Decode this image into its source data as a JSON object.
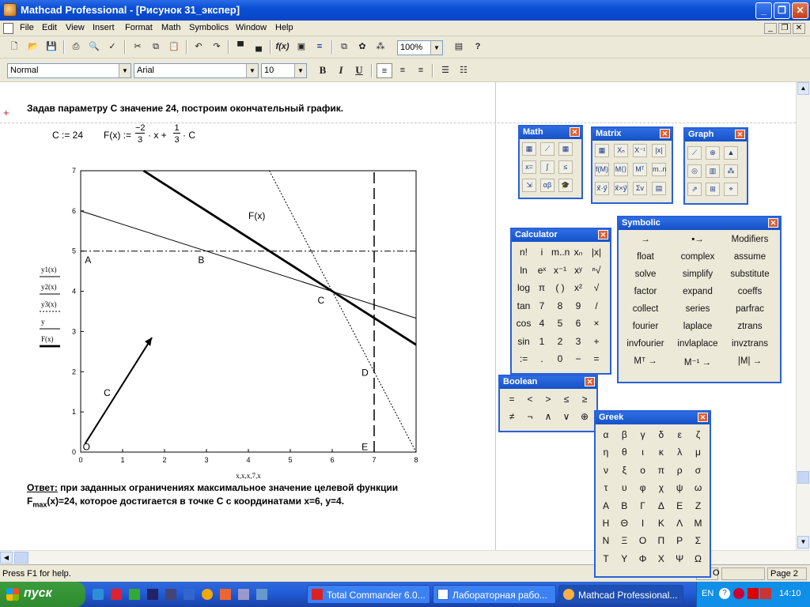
{
  "window": {
    "title": "Mathcad Professional - [Рисунок 31_экспер]"
  },
  "menu": [
    "File",
    "Edit",
    "View",
    "Insert",
    "Format",
    "Math",
    "Symbolics",
    "Window",
    "Help"
  ],
  "toolbar": {
    "zoom": "100%"
  },
  "format": {
    "style": "Normal",
    "font": "Arial",
    "size": "10",
    "bold": "B",
    "italic": "I",
    "underline": "U"
  },
  "document": {
    "heading": "Задав параметру C значение 24, построим окончательный график.",
    "formula": {
      "c_def": "C := 24",
      "f_def": "F(x) :=",
      "num1": "−2",
      "den1": "3",
      "mid": "· x +",
      "num2": "1",
      "den2": "3",
      "tail": "· C"
    },
    "answer_label": "Ответ:",
    "answer_text": " при заданных ограничениях максимальное значение целевой функции",
    "answer_line2_f": "F",
    "answer_line2_sub": "max",
    "answer_line2_rest": "(x)=24, которое достигается в точке C с координатами x=6, y=4."
  },
  "chart_data": {
    "type": "line",
    "xlabel": "x,x,x,7,x",
    "xlim": [
      0,
      8
    ],
    "ylim": [
      0,
      7
    ],
    "xticks": [
      "0",
      "1",
      "2",
      "3",
      "4",
      "5",
      "6",
      "7",
      "8"
    ],
    "yticks": [
      "0",
      "1",
      "2",
      "3",
      "4",
      "5",
      "6",
      "7"
    ],
    "legend": [
      "y1(x)",
      "y2(x)",
      "y3(x)",
      "y",
      "F(x)"
    ],
    "series": [
      {
        "name": "y1(x)",
        "style": "thin",
        "points": [
          [
            0,
            6
          ],
          [
            8,
            3.33
          ]
        ]
      },
      {
        "name": "y2(x)",
        "style": "dotted",
        "points": [
          [
            4.5,
            7
          ],
          [
            8,
            0
          ]
        ]
      },
      {
        "name": "y3(x)",
        "style": "dashdot",
        "points": [
          [
            0,
            5
          ],
          [
            8,
            5
          ]
        ]
      },
      {
        "name": "y",
        "style": "dashed",
        "points": [
          [
            7,
            0
          ],
          [
            7,
            7
          ]
        ]
      },
      {
        "name": "F(x)",
        "style": "thick",
        "points": [
          [
            1.5,
            7
          ],
          [
            8,
            2.67
          ]
        ]
      }
    ],
    "arrow": {
      "from": [
        0.1,
        0.2
      ],
      "to": [
        1.7,
        2.85
      ]
    },
    "annotations": [
      {
        "text": "F(x)",
        "x": 4,
        "y": 5.8
      },
      {
        "text": "A",
        "x": 0.1,
        "y": 4.7
      },
      {
        "text": "B",
        "x": 2.8,
        "y": 4.7
      },
      {
        "text": "C",
        "x": 5.65,
        "y": 3.7
      },
      {
        "text": "D",
        "x": 6.7,
        "y": 1.9
      },
      {
        "text": "E",
        "x": 6.7,
        "y": 0.05
      },
      {
        "text": "C",
        "x": 0.55,
        "y": 1.4
      },
      {
        "text": "O",
        "x": 0.05,
        "y": 0.05
      }
    ]
  },
  "palettes": {
    "math": "Math",
    "matrix": "Matrix",
    "graph": "Graph",
    "calculator": "Calculator",
    "symbolic": "Symbolic",
    "boolean": "Boolean",
    "greek": "Greek",
    "calc_rows": [
      [
        "n!",
        "i",
        "m..n",
        "xₙ",
        "|x|"
      ],
      [
        "ln",
        "eˣ",
        "x⁻¹",
        "xʸ",
        "ⁿ√"
      ],
      [
        "log",
        "π",
        "( )",
        "x²",
        "√"
      ],
      [
        "tan",
        "7",
        "8",
        "9",
        "/"
      ],
      [
        "cos",
        "4",
        "5",
        "6",
        "×"
      ],
      [
        "sin",
        "1",
        "2",
        "3",
        "+"
      ],
      [
        ":=",
        ".",
        "0",
        "−",
        "="
      ]
    ],
    "sym_rows": [
      [
        "→",
        "▪→",
        "Modifiers"
      ],
      [
        "float",
        "complex",
        "assume"
      ],
      [
        "solve",
        "simplify",
        "substitute"
      ],
      [
        "factor",
        "expand",
        "coeffs"
      ],
      [
        "collect",
        "series",
        "parfrac"
      ],
      [
        "fourier",
        "laplace",
        "ztrans"
      ],
      [
        "invfourier",
        "invlaplace",
        "invztrans"
      ],
      [
        "Mᵀ →",
        "M⁻¹ →",
        "|M| →"
      ]
    ],
    "bool_rows": [
      [
        "=",
        "<",
        ">",
        "≤",
        "≥"
      ],
      [
        "≠",
        "¬",
        "∧",
        "∨",
        "⊕"
      ]
    ],
    "greek_rows": [
      [
        "α",
        "β",
        "γ",
        "δ",
        "ε",
        "ζ"
      ],
      [
        "η",
        "θ",
        "ι",
        "κ",
        "λ",
        "μ"
      ],
      [
        "ν",
        "ξ",
        "ο",
        "π",
        "ρ",
        "σ"
      ],
      [
        "τ",
        "υ",
        "φ",
        "χ",
        "ψ",
        "ω"
      ],
      [
        "Α",
        "Β",
        "Γ",
        "Δ",
        "Ε",
        "Ζ"
      ],
      [
        "Η",
        "Θ",
        "Ι",
        "Κ",
        "Λ",
        "Μ"
      ],
      [
        "Ν",
        "Ξ",
        "Ο",
        "Π",
        "Ρ",
        "Σ"
      ],
      [
        "Τ",
        "Υ",
        "Φ",
        "Χ",
        "Ψ",
        "Ω"
      ]
    ],
    "math_icons": [
      "calc-icon",
      "graph-icon",
      "matrix-icon",
      "eval-icon",
      "calculus-icon",
      "boolean-icon",
      "program-icon",
      "greek-icon",
      "symbolic-icon"
    ],
    "matrix_icons": [
      "▦",
      "Xₙ",
      "X⁻¹",
      "|x|",
      "f(M)",
      "M⟨⟩",
      "Mᵀ",
      "m..n",
      "x⃗·y⃗",
      "x⃗×y⃗",
      "Σv",
      "▤"
    ]
  },
  "status": {
    "help": "Press F1 for help.",
    "mode": "O",
    "page": "Page 2"
  },
  "taskbar": {
    "start": "пуск",
    "tasks": [
      "Total Commander 6.0...",
      "Лабораторная рабо...",
      "Mathcad Professional..."
    ],
    "lang": "EN",
    "time": "14:10"
  }
}
